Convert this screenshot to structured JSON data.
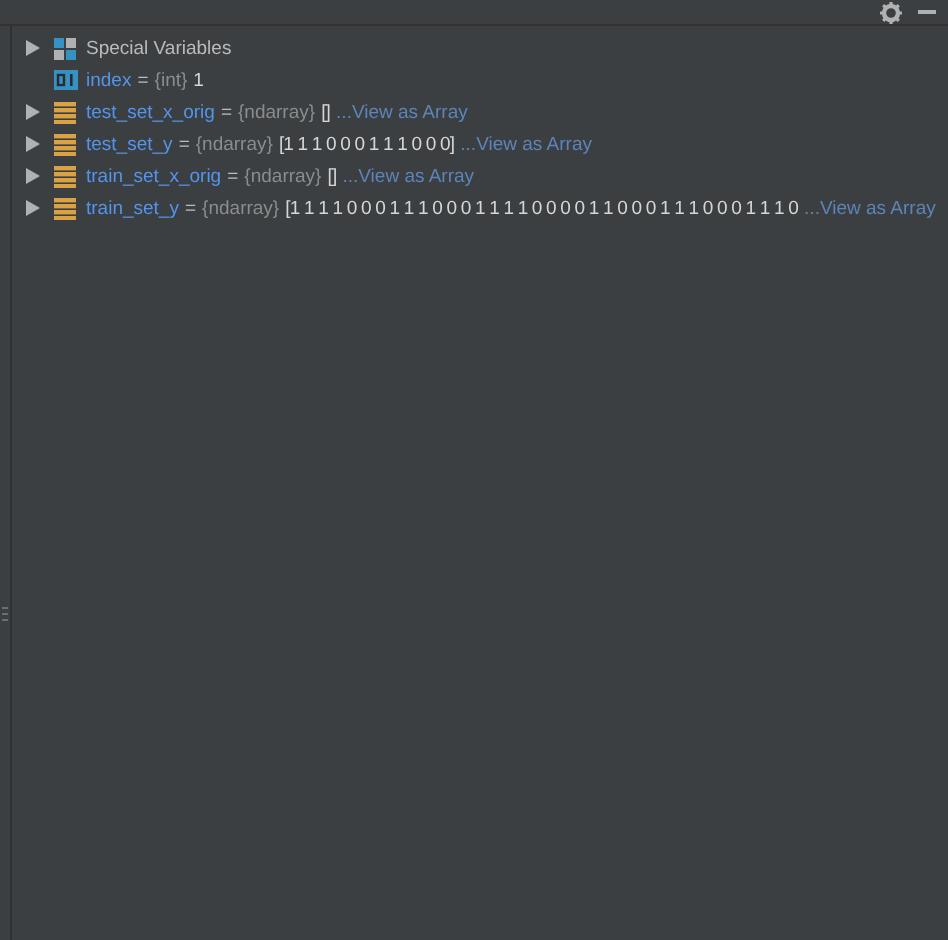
{
  "variables": [
    {
      "kind": "special",
      "expandable": true,
      "name": "Special Variables"
    },
    {
      "kind": "scalar",
      "expandable": false,
      "name": "index",
      "equals": "=",
      "type": "{int}",
      "value": "1"
    },
    {
      "kind": "array",
      "expandable": true,
      "name": "test_set_x_orig",
      "equals": "=",
      "type": "{ndarray}",
      "value": "[]",
      "link": "...View as Array"
    },
    {
      "kind": "array",
      "expandable": true,
      "name": "test_set_y",
      "equals": "=",
      "type": "{ndarray}",
      "value": "[1 1 1 0 0 0 1 1 1 0 0 0]",
      "link": "...View as Array"
    },
    {
      "kind": "array",
      "expandable": true,
      "name": "train_set_x_orig",
      "equals": "=",
      "type": "{ndarray}",
      "value": "[]",
      "link": "...View as Array"
    },
    {
      "kind": "array",
      "expandable": true,
      "name": "train_set_y",
      "equals": "=",
      "type": "{ndarray}",
      "value": "[1 1 1 1 0 0 0 1 1 1 0 0 0 1 1 1 1 0 0 0 0 1 1 0 0 0 1 1 1 0 0 0 1 1 1 0",
      "link": "...View as Array"
    }
  ]
}
